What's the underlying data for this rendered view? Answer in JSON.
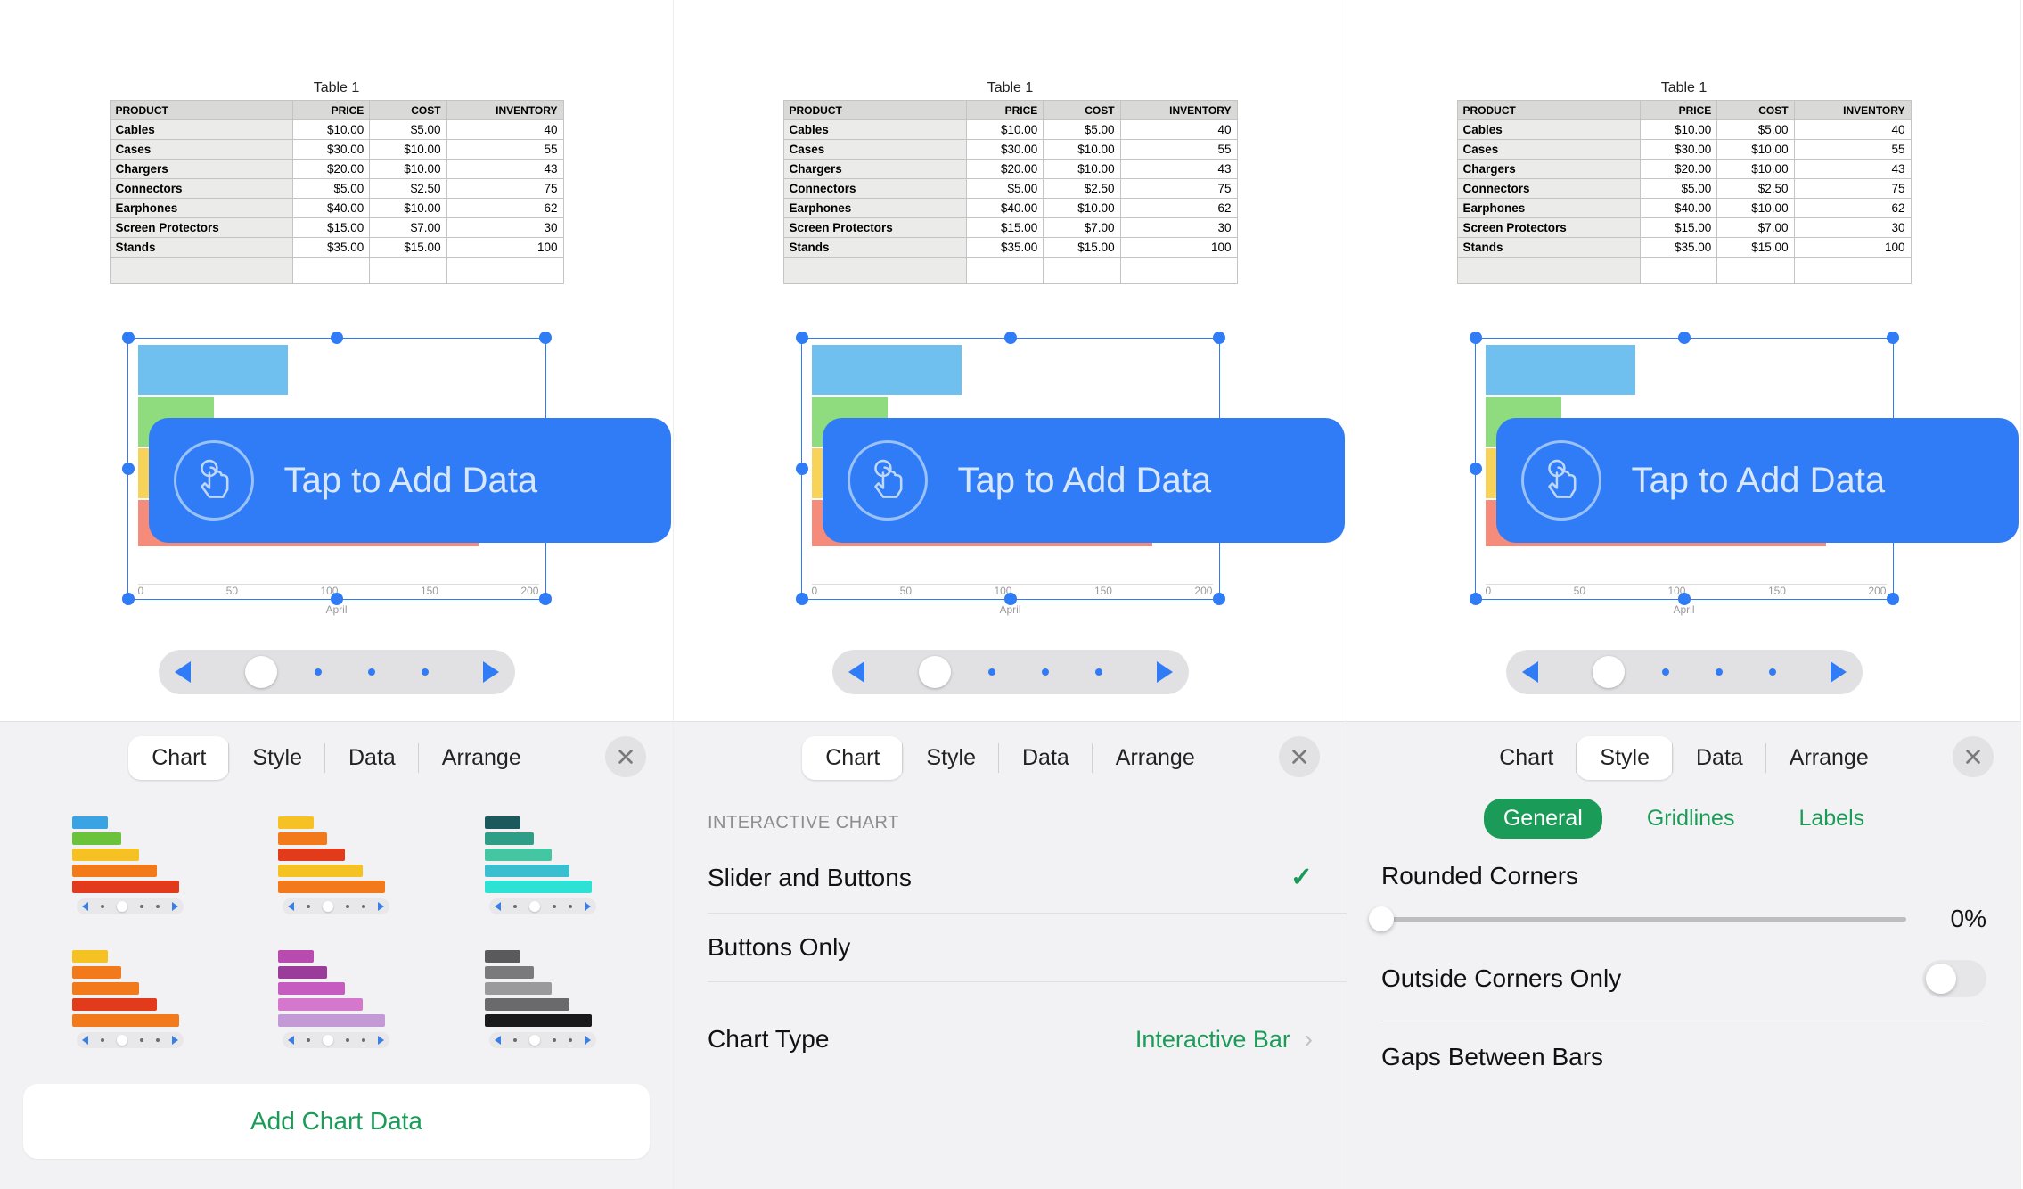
{
  "table": {
    "title": "Table 1",
    "headers": [
      "PRODUCT",
      "PRICE",
      "COST",
      "INVENTORY"
    ],
    "rows": [
      {
        "product": "Cables",
        "price": "$10.00",
        "cost": "$5.00",
        "inventory": "40"
      },
      {
        "product": "Cases",
        "price": "$30.00",
        "cost": "$10.00",
        "inventory": "55"
      },
      {
        "product": "Chargers",
        "price": "$20.00",
        "cost": "$10.00",
        "inventory": "43"
      },
      {
        "product": "Connectors",
        "price": "$5.00",
        "cost": "$2.50",
        "inventory": "75"
      },
      {
        "product": "Earphones",
        "price": "$40.00",
        "cost": "$10.00",
        "inventory": "62"
      },
      {
        "product": "Screen Protectors",
        "price": "$15.00",
        "cost": "$7.00",
        "inventory": "30"
      },
      {
        "product": "Stands",
        "price": "$35.00",
        "cost": "$15.00",
        "inventory": "100"
      }
    ]
  },
  "chart_data": {
    "type": "bar",
    "orientation": "horizontal",
    "xlabel": "April",
    "xlim": [
      0,
      200
    ],
    "ticks": [
      "0",
      "50",
      "100",
      "150",
      "200"
    ],
    "series_colors": [
      "#6fc0ef",
      "#8edc7d",
      "#f7d35a",
      "#f58b7a"
    ],
    "values": [
      75,
      38,
      48,
      170
    ]
  },
  "tap_callout": {
    "label": "Tap to Add Data"
  },
  "tabs": {
    "chart": "Chart",
    "style": "Style",
    "data": "Data",
    "arrange": "Arrange"
  },
  "panel1": {
    "active_tab": "chart",
    "add_chart_data": "Add Chart Data",
    "swatches": [
      [
        "#3aa3e3",
        "#6ac33a",
        "#f6c223",
        "#f27a1a",
        "#e23b1b"
      ],
      [
        "#f6c223",
        "#f27a1a",
        "#e23b1b",
        "#f6c223",
        "#f27a1a"
      ],
      [
        "#1a5a5c",
        "#2f9e87",
        "#44c6a3",
        "#3abed0",
        "#2de1d4"
      ],
      [
        "#f6c223",
        "#f27a1a",
        "#f27a1a",
        "#e23b1b",
        "#f27a1a"
      ],
      [
        "#b84bb0",
        "#9c3c9a",
        "#c75cc0",
        "#d577cd",
        "#c49ad6"
      ],
      [
        "#5a5a5c",
        "#7a7a7c",
        "#9a9a9c",
        "#6a6a6c",
        "#1a1a1c"
      ]
    ]
  },
  "panel2": {
    "active_tab": "chart",
    "section_header": "INTERACTIVE CHART",
    "row_slider_buttons": "Slider and Buttons",
    "row_buttons_only": "Buttons Only",
    "row_chart_type": "Chart Type",
    "chart_type_value": "Interactive Bar"
  },
  "panel3": {
    "active_tab": "style",
    "subtabs": {
      "general": "General",
      "gridlines": "Gridlines",
      "labels": "Labels"
    },
    "rounded_corners_label": "Rounded Corners",
    "rounded_corners_value": "0%",
    "outside_corners_label": "Outside Corners Only",
    "gaps_label": "Gaps Between Bars"
  }
}
